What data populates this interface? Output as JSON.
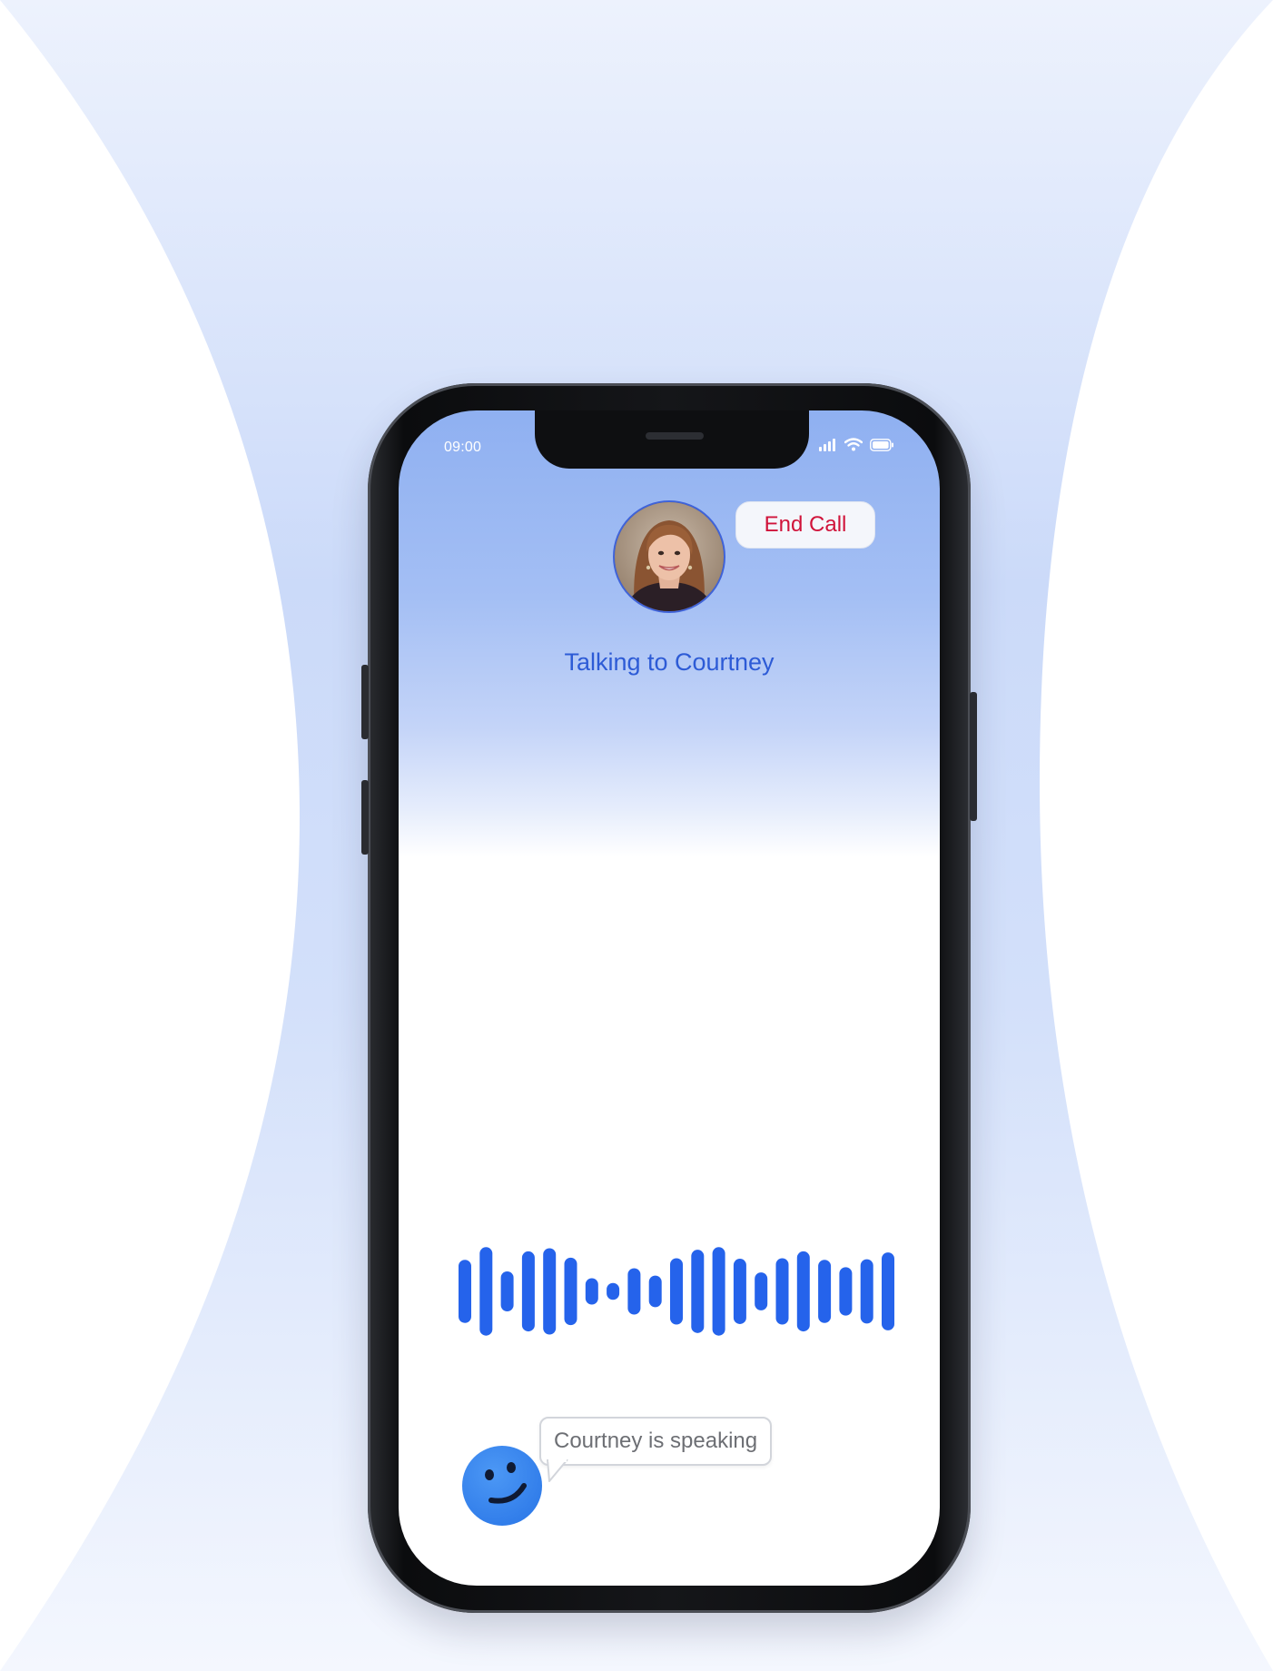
{
  "status_bar": {
    "time": "09:00",
    "icons": [
      "cellular-signal-icon",
      "wifi-icon",
      "battery-icon"
    ]
  },
  "call": {
    "end_call_label": "End Call",
    "title": "Talking to Courtney",
    "caller_avatar": "portrait-avatar"
  },
  "waveform": {
    "bar_color": "#2563eb",
    "levels": [
      0.6,
      0.84,
      0.38,
      0.76,
      0.82,
      0.64,
      0.25,
      0.16,
      0.44,
      0.3,
      0.63,
      0.79,
      0.84,
      0.62,
      0.36,
      0.63,
      0.76,
      0.6,
      0.46,
      0.61,
      0.74
    ]
  },
  "assistant": {
    "status_text": "Courtney is speaking",
    "icon": "smiley-icon"
  },
  "colors": {
    "accent": "#2d5bd6",
    "end_call": "#d0133a",
    "background_tint": "#c8d7f8"
  }
}
